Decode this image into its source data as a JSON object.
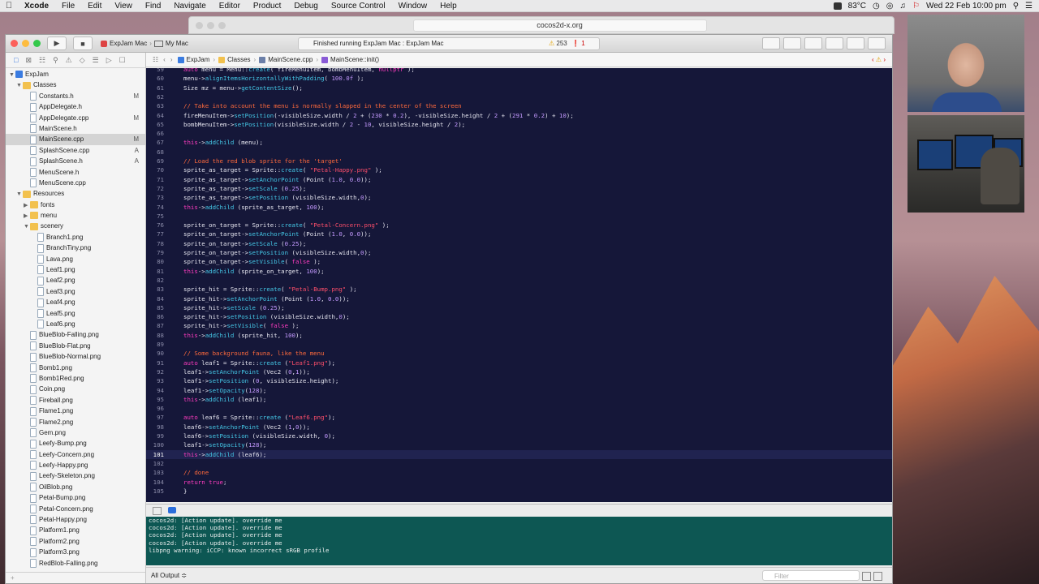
{
  "menubar": {
    "app": "Xcode",
    "items": [
      "File",
      "Edit",
      "View",
      "Find",
      "Navigate",
      "Editor",
      "Product",
      "Debug",
      "Source Control",
      "Window",
      "Help"
    ],
    "battery_temp": "83°C",
    "clock": "Wed 22 Feb  10:00 pm"
  },
  "browser": {
    "url": "cocos2d-x.org"
  },
  "toolbar": {
    "scheme": "ExpJam Mac",
    "destination": "My Mac",
    "status": "Finished running ExpJam Mac : ExpJam Mac",
    "warnings": "253",
    "errors": "1"
  },
  "navigator": {
    "rows": [
      {
        "label": "ExpJam",
        "kind": "proj",
        "indent": 0,
        "tri": "▼",
        "status": ""
      },
      {
        "label": "Classes",
        "kind": "folder",
        "indent": 1,
        "tri": "▼",
        "status": ""
      },
      {
        "label": "Constants.h",
        "kind": "file",
        "indent": 2,
        "tri": "",
        "status": "M"
      },
      {
        "label": "AppDelegate.h",
        "kind": "file",
        "indent": 2,
        "tri": "",
        "status": ""
      },
      {
        "label": "AppDelegate.cpp",
        "kind": "file",
        "indent": 2,
        "tri": "",
        "status": "M"
      },
      {
        "label": "MainScene.h",
        "kind": "file",
        "indent": 2,
        "tri": "",
        "status": ""
      },
      {
        "label": "MainScene.cpp",
        "kind": "file",
        "indent": 2,
        "tri": "",
        "status": "M",
        "selected": true
      },
      {
        "label": "SplashScene.cpp",
        "kind": "file",
        "indent": 2,
        "tri": "",
        "status": "A"
      },
      {
        "label": "SplashScene.h",
        "kind": "file",
        "indent": 2,
        "tri": "",
        "status": "A"
      },
      {
        "label": "MenuScene.h",
        "kind": "file",
        "indent": 2,
        "tri": "",
        "status": ""
      },
      {
        "label": "MenuScene.cpp",
        "kind": "file",
        "indent": 2,
        "tri": "",
        "status": ""
      },
      {
        "label": "Resources",
        "kind": "folder",
        "indent": 1,
        "tri": "▼",
        "status": ""
      },
      {
        "label": "fonts",
        "kind": "folder",
        "indent": 2,
        "tri": "▶",
        "status": ""
      },
      {
        "label": "menu",
        "kind": "folder",
        "indent": 2,
        "tri": "▶",
        "status": ""
      },
      {
        "label": "scenery",
        "kind": "folder",
        "indent": 2,
        "tri": "▼",
        "status": ""
      },
      {
        "label": "Branch1.png",
        "kind": "file",
        "indent": 3,
        "tri": "",
        "status": ""
      },
      {
        "label": "BranchTiny.png",
        "kind": "file",
        "indent": 3,
        "tri": "",
        "status": ""
      },
      {
        "label": "Lava.png",
        "kind": "file",
        "indent": 3,
        "tri": "",
        "status": ""
      },
      {
        "label": "Leaf1.png",
        "kind": "file",
        "indent": 3,
        "tri": "",
        "status": ""
      },
      {
        "label": "Leaf2.png",
        "kind": "file",
        "indent": 3,
        "tri": "",
        "status": ""
      },
      {
        "label": "Leaf3.png",
        "kind": "file",
        "indent": 3,
        "tri": "",
        "status": ""
      },
      {
        "label": "Leaf4.png",
        "kind": "file",
        "indent": 3,
        "tri": "",
        "status": ""
      },
      {
        "label": "Leaf5.png",
        "kind": "file",
        "indent": 3,
        "tri": "",
        "status": ""
      },
      {
        "label": "Leaf6.png",
        "kind": "file",
        "indent": 3,
        "tri": "",
        "status": ""
      },
      {
        "label": "BlueBlob-Falling.png",
        "kind": "file",
        "indent": 2,
        "tri": "",
        "status": ""
      },
      {
        "label": "BlueBlob-Flat.png",
        "kind": "file",
        "indent": 2,
        "tri": "",
        "status": ""
      },
      {
        "label": "BlueBlob-Normal.png",
        "kind": "file",
        "indent": 2,
        "tri": "",
        "status": ""
      },
      {
        "label": "Bomb1.png",
        "kind": "file",
        "indent": 2,
        "tri": "",
        "status": ""
      },
      {
        "label": "Bomb1Red.png",
        "kind": "file",
        "indent": 2,
        "tri": "",
        "status": ""
      },
      {
        "label": "Coin.png",
        "kind": "file",
        "indent": 2,
        "tri": "",
        "status": ""
      },
      {
        "label": "Fireball.png",
        "kind": "file",
        "indent": 2,
        "tri": "",
        "status": ""
      },
      {
        "label": "Flame1.png",
        "kind": "file",
        "indent": 2,
        "tri": "",
        "status": ""
      },
      {
        "label": "Flame2.png",
        "kind": "file",
        "indent": 2,
        "tri": "",
        "status": ""
      },
      {
        "label": "Gem.png",
        "kind": "file",
        "indent": 2,
        "tri": "",
        "status": ""
      },
      {
        "label": "Leefy-Bump.png",
        "kind": "file",
        "indent": 2,
        "tri": "",
        "status": ""
      },
      {
        "label": "Leefy-Concern.png",
        "kind": "file",
        "indent": 2,
        "tri": "",
        "status": ""
      },
      {
        "label": "Leefy-Happy.png",
        "kind": "file",
        "indent": 2,
        "tri": "",
        "status": ""
      },
      {
        "label": "Leefy-Skeleton.png",
        "kind": "file",
        "indent": 2,
        "tri": "",
        "status": ""
      },
      {
        "label": "OilBlob.png",
        "kind": "file",
        "indent": 2,
        "tri": "",
        "status": ""
      },
      {
        "label": "Petal-Bump.png",
        "kind": "file",
        "indent": 2,
        "tri": "",
        "status": ""
      },
      {
        "label": "Petal-Concern.png",
        "kind": "file",
        "indent": 2,
        "tri": "",
        "status": ""
      },
      {
        "label": "Petal-Happy.png",
        "kind": "file",
        "indent": 2,
        "tri": "",
        "status": ""
      },
      {
        "label": "Platform1.png",
        "kind": "file",
        "indent": 2,
        "tri": "",
        "status": ""
      },
      {
        "label": "Platform2.png",
        "kind": "file",
        "indent": 2,
        "tri": "",
        "status": ""
      },
      {
        "label": "Platform3.png",
        "kind": "file",
        "indent": 2,
        "tri": "",
        "status": ""
      },
      {
        "label": "RedBlob-Falling.png",
        "kind": "file",
        "indent": 2,
        "tri": "",
        "status": ""
      }
    ]
  },
  "jumpbar": {
    "crumbs": [
      "ExpJam",
      "Classes",
      "MainScene.cpp",
      "MainScene::init()"
    ]
  },
  "editor": {
    "current_line": 101,
    "lines": [
      {
        "n": "59",
        "t": "auto menu = Menu::create( fireMenuItem, bombMenuItem, nullptr );"
      },
      {
        "n": "60",
        "t": "menu->alignItemsHorizontallyWithPadding( 100.0f );"
      },
      {
        "n": "61",
        "t": "Size mz = menu->getContentSize();"
      },
      {
        "n": "62",
        "t": ""
      },
      {
        "n": "63",
        "t": "// Take into account the menu is normally slapped in the center of the screen"
      },
      {
        "n": "64",
        "t": "fireMenuItem->setPosition(-visibleSize.width / 2 + (230 * 0.2), -visibleSize.height / 2 + (291 * 0.2) + 10);"
      },
      {
        "n": "65",
        "t": "bombMenuItem->setPosition(visibleSize.width / 2 - 10, visibleSize.height / 2);"
      },
      {
        "n": "66",
        "t": ""
      },
      {
        "n": "67",
        "t": "this->addChild (menu);"
      },
      {
        "n": "68",
        "t": ""
      },
      {
        "n": "69",
        "t": "// Load the red blob sprite for the 'target'"
      },
      {
        "n": "70",
        "t": "sprite_as_target = Sprite::create( \"Petal-Happy.png\" );"
      },
      {
        "n": "71",
        "t": "sprite_as_target->setAnchorPoint (Point (1.0, 0.0));"
      },
      {
        "n": "72",
        "t": "sprite_as_target->setScale (0.25);"
      },
      {
        "n": "73",
        "t": "sprite_as_target->setPosition (visibleSize.width,0);"
      },
      {
        "n": "74",
        "t": "this->addChild (sprite_as_target, 100);"
      },
      {
        "n": "75",
        "t": ""
      },
      {
        "n": "76",
        "t": "sprite_on_target = Sprite::create( \"Petal-Concern.png\" );"
      },
      {
        "n": "77",
        "t": "sprite_on_target->setAnchorPoint (Point (1.0, 0.0));"
      },
      {
        "n": "78",
        "t": "sprite_on_target->setScale (0.25);"
      },
      {
        "n": "79",
        "t": "sprite_on_target->setPosition (visibleSize.width,0);"
      },
      {
        "n": "80",
        "t": "sprite_on_target->setVisible( false );"
      },
      {
        "n": "81",
        "t": "this->addChild (sprite_on_target, 100);"
      },
      {
        "n": "82",
        "t": ""
      },
      {
        "n": "83",
        "t": "sprite_hit = Sprite::create( \"Petal-Bump.png\" );"
      },
      {
        "n": "84",
        "t": "sprite_hit->setAnchorPoint (Point (1.0, 0.0));"
      },
      {
        "n": "85",
        "t": "sprite_hit->setScale (0.25);"
      },
      {
        "n": "86",
        "t": "sprite_hit->setPosition (visibleSize.width,0);"
      },
      {
        "n": "87",
        "t": "sprite_hit->setVisible( false );"
      },
      {
        "n": "88",
        "t": "this->addChild (sprite_hit, 100);"
      },
      {
        "n": "89",
        "t": ""
      },
      {
        "n": "90",
        "t": "// Some background fauna, like the menu"
      },
      {
        "n": "91",
        "t": "auto leaf1 = Sprite::create (\"Leaf1.png\");"
      },
      {
        "n": "92",
        "t": "leaf1->setAnchorPoint (Vec2 (0,1));"
      },
      {
        "n": "93",
        "t": "leaf1->setPosition (0, visibleSize.height);"
      },
      {
        "n": "94",
        "t": "leaf1->setOpacity(128);"
      },
      {
        "n": "95",
        "t": "this->addChild (leaf1);"
      },
      {
        "n": "96",
        "t": ""
      },
      {
        "n": "97",
        "t": "auto leaf6 = Sprite::create (\"Leaf6.png\");"
      },
      {
        "n": "98",
        "t": "leaf6->setAnchorPoint (Vec2 (1,0));"
      },
      {
        "n": "99",
        "t": "leaf6->setPosition (visibleSize.width, 0);"
      },
      {
        "n": "100",
        "t": "leaf1->setOpacity(128);"
      },
      {
        "n": "101",
        "t": "this->addChild (leaf6);"
      },
      {
        "n": "102",
        "t": ""
      },
      {
        "n": "103",
        "t": "// done"
      },
      {
        "n": "104",
        "t": "return true;"
      },
      {
        "n": "105",
        "t": "}"
      }
    ]
  },
  "console": {
    "lines": [
      "cocos2d: [Action update]. override me",
      "cocos2d: [Action update]. override me",
      "cocos2d: [Action update]. override me",
      "cocos2d: [Action update]. override me",
      "libpng warning: iCCP: known incorrect sRGB profile"
    ]
  },
  "statusbar": {
    "output_selector": "All Output ≎",
    "filter_placeholder": "Filter"
  },
  "colors": {
    "editor_bg": "#151739",
    "console_bg": "#0d5753",
    "keyword": "#ff3cc0",
    "comment": "#ff6a3c",
    "method": "#45c9e8",
    "string": "#ff4f6b"
  }
}
